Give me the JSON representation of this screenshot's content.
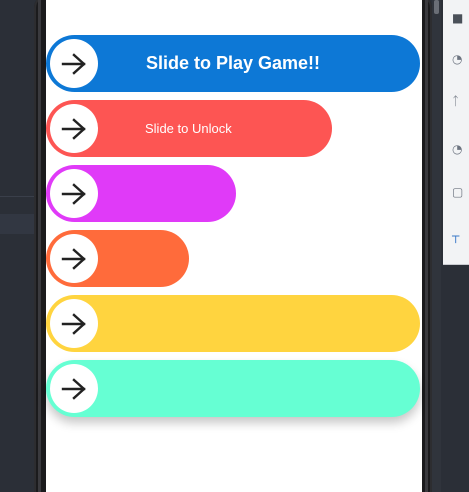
{
  "colors": {
    "slider_1": "#0d78d6",
    "slider_2": "#fd5553",
    "slider_3": "#e03af8",
    "slider_4": "#ff6b3b",
    "slider_5": "#ffd43f",
    "slider_6": "#66ffd3",
    "knob": "#ffffff",
    "arrow": "#222222",
    "ide_background": "#2b2f37"
  },
  "icons": {
    "knob": "arrow-right-icon"
  },
  "sliders": [
    {
      "label": "Slide to Play Game!!",
      "color": "#0d78d6"
    },
    {
      "label": "Slide to Unlock",
      "color": "#fd5553"
    },
    {
      "label": "",
      "color": "#e03af8"
    },
    {
      "label": "",
      "color": "#ff6b3b"
    },
    {
      "label": "",
      "color": "#ffd43f"
    },
    {
      "label": "",
      "color": "#66ffd3"
    }
  ]
}
